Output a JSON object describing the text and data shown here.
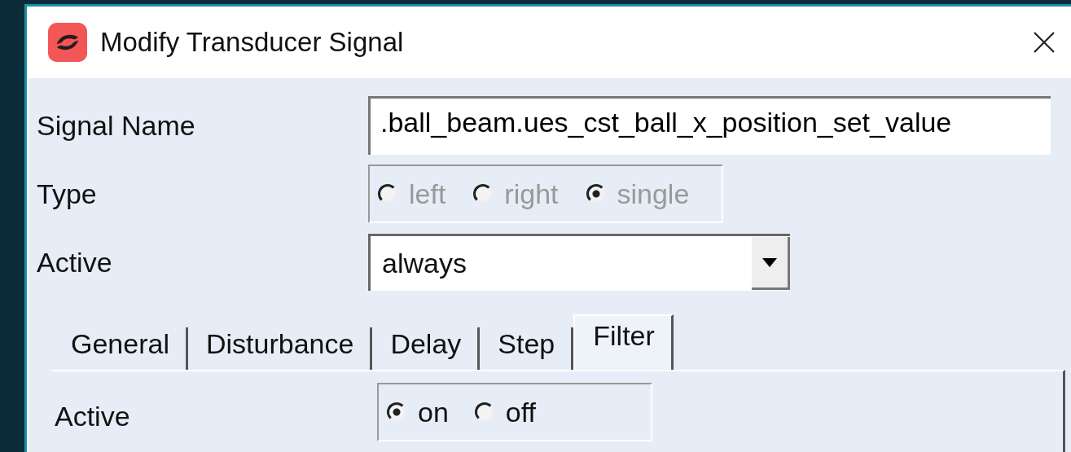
{
  "window": {
    "title": "Modify Transducer Signal"
  },
  "signal_name": {
    "label": "Signal Name",
    "value": ".ball_beam.ues_cst_ball_x_position_set_value"
  },
  "type": {
    "label": "Type",
    "disabled": true,
    "options": [
      {
        "label": "left",
        "selected": false
      },
      {
        "label": "right",
        "selected": false
      },
      {
        "label": "single",
        "selected": true
      }
    ]
  },
  "active": {
    "label": "Active",
    "value": "always"
  },
  "tabs": [
    {
      "label": "General",
      "selected": false
    },
    {
      "label": "Disturbance",
      "selected": false
    },
    {
      "label": "Delay",
      "selected": false
    },
    {
      "label": "Step",
      "selected": false
    },
    {
      "label": "Filter",
      "selected": true
    }
  ],
  "filter": {
    "active": {
      "label": "Active",
      "disabled": false,
      "options": [
        {
          "label": "on",
          "selected": true
        },
        {
          "label": "off",
          "selected": false
        }
      ]
    }
  }
}
